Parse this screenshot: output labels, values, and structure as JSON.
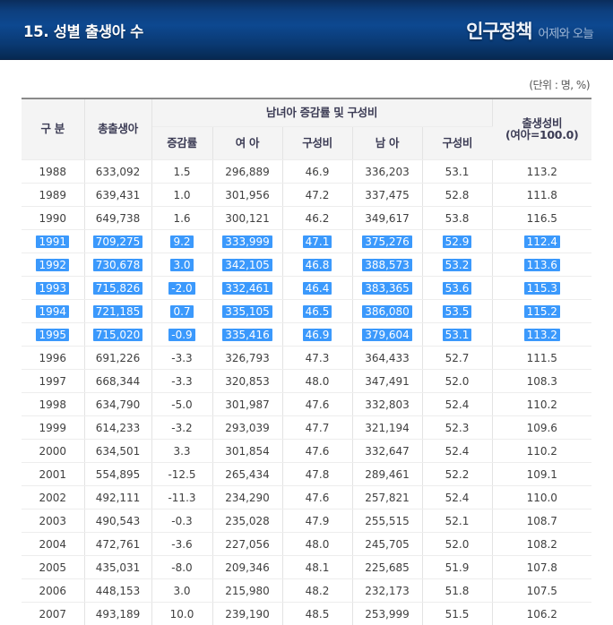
{
  "banner": {
    "title": "15. 성별 출생아 수",
    "brand_main": "인구정책",
    "brand_sub": "어제와 오늘"
  },
  "unit_note": "(단위 : 명, %)",
  "table": {
    "headers": {
      "gubun": "구 분",
      "total_births": "총출생아",
      "group": "남녀아 증감률 및 구성비",
      "rate": "증감률",
      "female": "여 아",
      "female_share": "구성비",
      "male": "남 아",
      "male_share": "구성비",
      "sex_ratio_line1": "출생성비",
      "sex_ratio_line2": "(여아=100.0)"
    },
    "selected_years": [
      "1991",
      "1992",
      "1993",
      "1994",
      "1995"
    ],
    "rows": [
      {
        "year": "1988",
        "total": "633,092",
        "rate": "1.5",
        "female": "296,889",
        "female_share": "46.9",
        "male": "336,203",
        "male_share": "53.1",
        "sex_ratio": "113.2"
      },
      {
        "year": "1989",
        "total": "639,431",
        "rate": "1.0",
        "female": "301,956",
        "female_share": "47.2",
        "male": "337,475",
        "male_share": "52.8",
        "sex_ratio": "111.8"
      },
      {
        "year": "1990",
        "total": "649,738",
        "rate": "1.6",
        "female": "300,121",
        "female_share": "46.2",
        "male": "349,617",
        "male_share": "53.8",
        "sex_ratio": "116.5"
      },
      {
        "year": "1991",
        "total": "709,275",
        "rate": "9.2",
        "female": "333,999",
        "female_share": "47.1",
        "male": "375,276",
        "male_share": "52.9",
        "sex_ratio": "112.4"
      },
      {
        "year": "1992",
        "total": "730,678",
        "rate": "3.0",
        "female": "342,105",
        "female_share": "46.8",
        "male": "388,573",
        "male_share": "53.2",
        "sex_ratio": "113.6"
      },
      {
        "year": "1993",
        "total": "715,826",
        "rate": "-2.0",
        "female": "332,461",
        "female_share": "46.4",
        "male": "383,365",
        "male_share": "53.6",
        "sex_ratio": "115.3"
      },
      {
        "year": "1994",
        "total": "721,185",
        "rate": "0.7",
        "female": "335,105",
        "female_share": "46.5",
        "male": "386,080",
        "male_share": "53.5",
        "sex_ratio": "115.2"
      },
      {
        "year": "1995",
        "total": "715,020",
        "rate": "-0.9",
        "female": "335,416",
        "female_share": "46.9",
        "male": "379,604",
        "male_share": "53.1",
        "sex_ratio": "113.2"
      },
      {
        "year": "1996",
        "total": "691,226",
        "rate": "-3.3",
        "female": "326,793",
        "female_share": "47.3",
        "male": "364,433",
        "male_share": "52.7",
        "sex_ratio": "111.5"
      },
      {
        "year": "1997",
        "total": "668,344",
        "rate": "-3.3",
        "female": "320,853",
        "female_share": "48.0",
        "male": "347,491",
        "male_share": "52.0",
        "sex_ratio": "108.3"
      },
      {
        "year": "1998",
        "total": "634,790",
        "rate": "-5.0",
        "female": "301,987",
        "female_share": "47.6",
        "male": "332,803",
        "male_share": "52.4",
        "sex_ratio": "110.2"
      },
      {
        "year": "1999",
        "total": "614,233",
        "rate": "-3.2",
        "female": "293,039",
        "female_share": "47.7",
        "male": "321,194",
        "male_share": "52.3",
        "sex_ratio": "109.6"
      },
      {
        "year": "2000",
        "total": "634,501",
        "rate": "3.3",
        "female": "301,854",
        "female_share": "47.6",
        "male": "332,647",
        "male_share": "52.4",
        "sex_ratio": "110.2"
      },
      {
        "year": "2001",
        "total": "554,895",
        "rate": "-12.5",
        "female": "265,434",
        "female_share": "47.8",
        "male": "289,461",
        "male_share": "52.2",
        "sex_ratio": "109.1"
      },
      {
        "year": "2002",
        "total": "492,111",
        "rate": "-11.3",
        "female": "234,290",
        "female_share": "47.6",
        "male": "257,821",
        "male_share": "52.4",
        "sex_ratio": "110.0"
      },
      {
        "year": "2003",
        "total": "490,543",
        "rate": "-0.3",
        "female": "235,028",
        "female_share": "47.9",
        "male": "255,515",
        "male_share": "52.1",
        "sex_ratio": "108.7"
      },
      {
        "year": "2004",
        "total": "472,761",
        "rate": "-3.6",
        "female": "227,056",
        "female_share": "48.0",
        "male": "245,705",
        "male_share": "52.0",
        "sex_ratio": "108.2"
      },
      {
        "year": "2005",
        "total": "435,031",
        "rate": "-8.0",
        "female": "209,346",
        "female_share": "48.1",
        "male": "225,685",
        "male_share": "51.9",
        "sex_ratio": "107.8"
      },
      {
        "year": "2006",
        "total": "448,153",
        "rate": "3.0",
        "female": "215,980",
        "female_share": "48.2",
        "male": "232,173",
        "male_share": "51.8",
        "sex_ratio": "107.5"
      },
      {
        "year": "2007",
        "total": "493,189",
        "rate": "10.0",
        "female": "239,190",
        "female_share": "48.5",
        "male": "253,999",
        "male_share": "51.5",
        "sex_ratio": "106.2"
      }
    ]
  },
  "colors": {
    "banner_blue": "#0d4890",
    "banner_dark": "#06284f",
    "selection_blue": "#3b99fc",
    "header_bg": "#f4f4f4",
    "header_text": "#3c3c55"
  }
}
